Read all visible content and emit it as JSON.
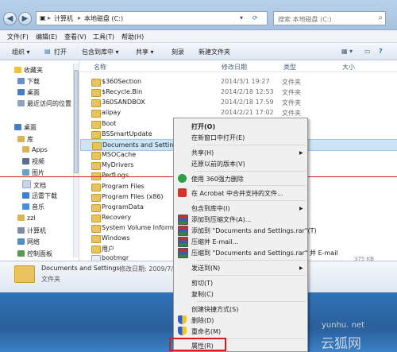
{
  "address": {
    "seg1": "计算机",
    "seg2": "本地磁盘 (C:)"
  },
  "search": {
    "placeholder": "搜索 本地磁盘 (C:)"
  },
  "menubar": [
    "文件(F)",
    "编辑(E)",
    "查看(V)",
    "工具(T)",
    "帮助(H)"
  ],
  "toolbar": {
    "organize": "组织",
    "open": "打开",
    "include": "包含到库中",
    "share": "共享",
    "burn": "刻录",
    "newfolder": "新建文件夹"
  },
  "nav": {
    "favorites": "收藏夹",
    "downloads": "下载",
    "desktop": "桌面",
    "recent": "最近访问的位置",
    "desktop2": "桌面",
    "libraries": "库",
    "apps": "Apps",
    "videos": "视频",
    "pictures": "图片",
    "documents": "文档",
    "xunlei": "迅雷下载",
    "music": "音乐",
    "zzl": "zzl",
    "computer": "计算机",
    "network": "网络",
    "controlpanel": "控制面板"
  },
  "columns": {
    "name": "名称",
    "date": "修改日期",
    "type": "类型",
    "size": "大小"
  },
  "files": [
    {
      "name": "$360Section",
      "date": "2014/3/1 19:27",
      "type": "文件夹"
    },
    {
      "name": "$Recycle.Bin",
      "date": "2014/2/18 12:53",
      "type": "文件夹"
    },
    {
      "name": "360SANDBOX",
      "date": "2014/2/18 17:59",
      "type": "文件夹"
    },
    {
      "name": "alipay",
      "date": "2014/2/21 17:02",
      "type": "文件夹"
    },
    {
      "name": "Boot",
      "date": "",
      "type": ""
    },
    {
      "name": "BSSmartUpdate",
      "date": "",
      "type": ""
    },
    {
      "name": "Documents and Settings",
      "date": "",
      "type": ""
    },
    {
      "name": "MSOCache",
      "date": "",
      "type": ""
    },
    {
      "name": "MyDrivers",
      "date": "",
      "type": ""
    },
    {
      "name": "PerfLogs",
      "date": "",
      "type": ""
    },
    {
      "name": "Program Files",
      "date": "",
      "type": ""
    },
    {
      "name": "Program Files (x86)",
      "date": "",
      "type": ""
    },
    {
      "name": "ProgramData",
      "date": "",
      "type": ""
    },
    {
      "name": "Recovery",
      "date": "",
      "type": ""
    },
    {
      "name": "System Volume Informat",
      "date": "",
      "type": ""
    },
    {
      "name": "Windows",
      "date": "",
      "type": ""
    },
    {
      "name": "用户",
      "date": "",
      "type": ""
    },
    {
      "name": "bootmgr",
      "date": "",
      "type": ""
    }
  ],
  "details": {
    "name": "Documents and Settings",
    "meta": "修改日期: 2009/7/1",
    "type": "文件夹",
    "size_tail": "375 KB"
  },
  "context_menu": {
    "open": "打开(O)",
    "open_new": "在新窗口中打开(E)",
    "share": "共享(H)",
    "restore": "还原以前的版本(V)",
    "delete360": "使用 360强力删除",
    "acrobat": "在 Acrobat 中合并支持的文件...",
    "include": "包含到库中(I)",
    "addarchive": "添加到压缩文件(A)...",
    "addrar": "添加到 \"Documents and Settings.rar\"(T)",
    "email": "压缩并 E-mail...",
    "emailrar": "压缩到 \"Documents and Settings.rar\" 并 E-mail",
    "sendto": "发送到(N)",
    "cut": "剪切(T)",
    "copy": "复制(C)",
    "shortcut": "创建快捷方式(S)",
    "delete": "删除(D)",
    "rename": "重命名(M)",
    "properties": "属性(R)"
  },
  "watermark": {
    "url": "yunhu. net",
    "text": "云狐网"
  },
  "colors": {
    "selection": "#cce4f7",
    "highlight_box": "#d41f1f",
    "red_line": "#d61c1c"
  }
}
